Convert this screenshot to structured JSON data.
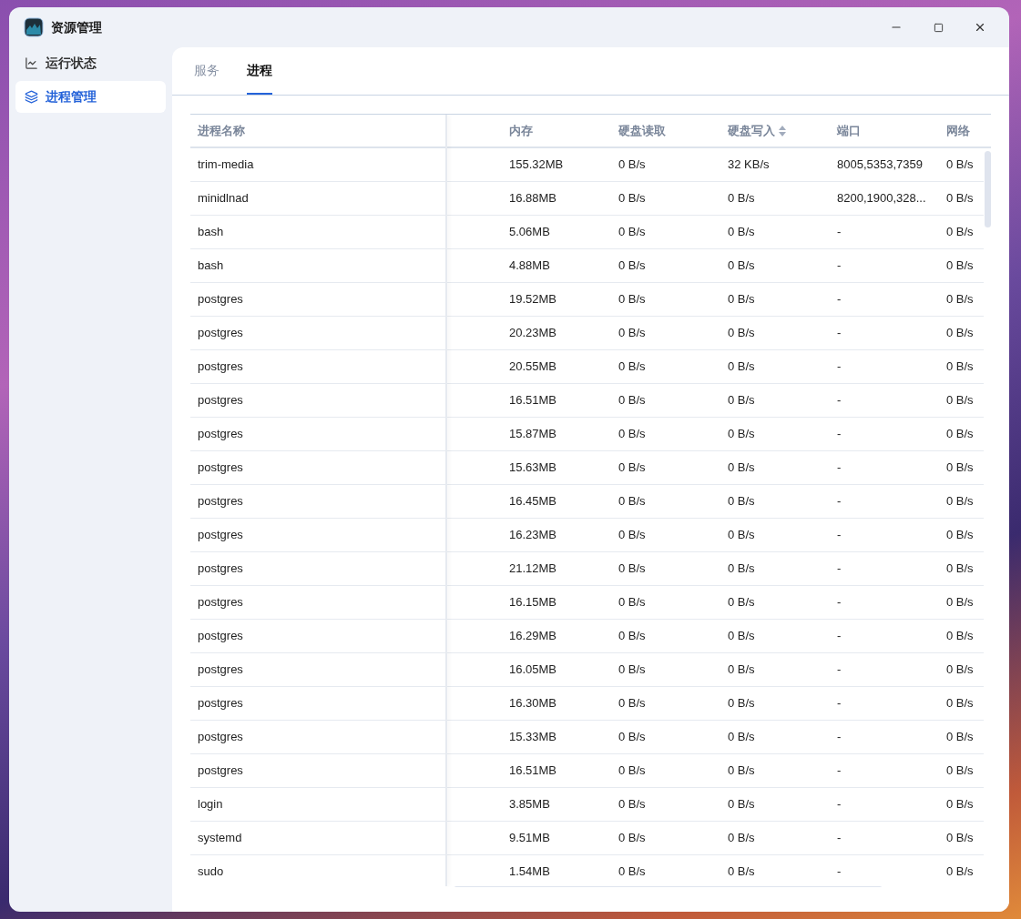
{
  "window": {
    "title": "资源管理"
  },
  "sidebar": {
    "items": [
      {
        "label": "运行状态",
        "kind": "chart",
        "selected": false
      },
      {
        "label": "进程管理",
        "kind": "layers",
        "selected": true
      }
    ]
  },
  "tabs": [
    {
      "label": "服务",
      "selected": false
    },
    {
      "label": "进程",
      "selected": true
    }
  ],
  "table": {
    "columns": [
      {
        "label": "进程名称",
        "sortable": false
      },
      {
        "label": "内存",
        "sortable": false
      },
      {
        "label": "硬盘读取",
        "sortable": false
      },
      {
        "label": "硬盘写入",
        "sortable": true
      },
      {
        "label": "端口",
        "sortable": false
      },
      {
        "label": "网络",
        "sortable": false
      }
    ],
    "rows": [
      [
        "trim-media",
        "155.32MB",
        "0 B/s",
        "32 KB/s",
        "8005,5353,7359",
        "0 B/s"
      ],
      [
        "minidlnad",
        "16.88MB",
        "0 B/s",
        "0 B/s",
        "8200,1900,328...",
        "0 B/s"
      ],
      [
        "bash",
        "5.06MB",
        "0 B/s",
        "0 B/s",
        "-",
        "0 B/s"
      ],
      [
        "bash",
        "4.88MB",
        "0 B/s",
        "0 B/s",
        "-",
        "0 B/s"
      ],
      [
        "postgres",
        "19.52MB",
        "0 B/s",
        "0 B/s",
        "-",
        "0 B/s"
      ],
      [
        "postgres",
        "20.23MB",
        "0 B/s",
        "0 B/s",
        "-",
        "0 B/s"
      ],
      [
        "postgres",
        "20.55MB",
        "0 B/s",
        "0 B/s",
        "-",
        "0 B/s"
      ],
      [
        "postgres",
        "16.51MB",
        "0 B/s",
        "0 B/s",
        "-",
        "0 B/s"
      ],
      [
        "postgres",
        "15.87MB",
        "0 B/s",
        "0 B/s",
        "-",
        "0 B/s"
      ],
      [
        "postgres",
        "15.63MB",
        "0 B/s",
        "0 B/s",
        "-",
        "0 B/s"
      ],
      [
        "postgres",
        "16.45MB",
        "0 B/s",
        "0 B/s",
        "-",
        "0 B/s"
      ],
      [
        "postgres",
        "16.23MB",
        "0 B/s",
        "0 B/s",
        "-",
        "0 B/s"
      ],
      [
        "postgres",
        "21.12MB",
        "0 B/s",
        "0 B/s",
        "-",
        "0 B/s"
      ],
      [
        "postgres",
        "16.15MB",
        "0 B/s",
        "0 B/s",
        "-",
        "0 B/s"
      ],
      [
        "postgres",
        "16.29MB",
        "0 B/s",
        "0 B/s",
        "-",
        "0 B/s"
      ],
      [
        "postgres",
        "16.05MB",
        "0 B/s",
        "0 B/s",
        "-",
        "0 B/s"
      ],
      [
        "postgres",
        "16.30MB",
        "0 B/s",
        "0 B/s",
        "-",
        "0 B/s"
      ],
      [
        "postgres",
        "15.33MB",
        "0 B/s",
        "0 B/s",
        "-",
        "0 B/s"
      ],
      [
        "postgres",
        "16.51MB",
        "0 B/s",
        "0 B/s",
        "-",
        "0 B/s"
      ],
      [
        "login",
        "3.85MB",
        "0 B/s",
        "0 B/s",
        "-",
        "0 B/s"
      ],
      [
        "systemd",
        "9.51MB",
        "0 B/s",
        "0 B/s",
        "-",
        "0 B/s"
      ],
      [
        "sudo",
        "1.54MB",
        "0 B/s",
        "0 B/s",
        "-",
        "0 B/s"
      ]
    ]
  }
}
